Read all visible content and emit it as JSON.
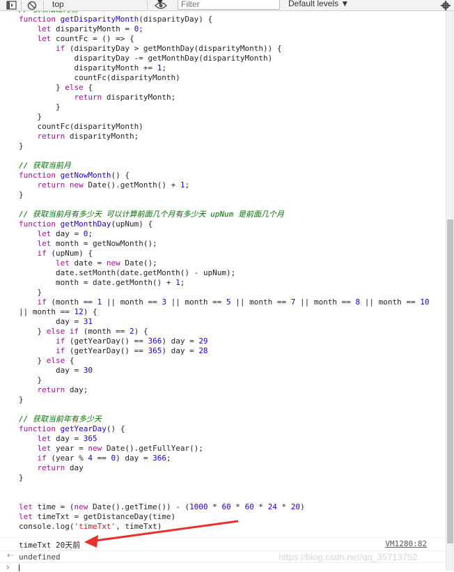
{
  "toolbar": {
    "context": "top",
    "filter_placeholder": "Filter",
    "levels": "Default levels ▼"
  },
  "code_lines": [
    "// 获取相差月份",
    "function getDisparityMonth(disparityDay) {",
    "    let disparityMonth = 0;",
    "    let countFc = () => {",
    "        if (disparityDay > getMonthDay(disparityMonth)) {",
    "            disparityDay -= getMonthDay(disparityMonth)",
    "            disparityMonth += 1;",
    "            countFc(disparityMonth)",
    "        } else {",
    "            return disparityMonth;",
    "        }",
    "    }",
    "    countFc(disparityMonth)",
    "    return disparityMonth;",
    "}",
    "",
    "// 获取当前月",
    "function getNowMonth() {",
    "    return new Date().getMonth() + 1;",
    "}",
    "",
    "// 获取当前月有多少天 可以计算前面几个月有多少天 upNum 是前面几个月",
    "function getMonthDay(upNum) {",
    "    let day = 0;",
    "    let month = getNowMonth();",
    "    if (upNum) {",
    "        let date = new Date();",
    "        date.setMonth(date.getMonth() - upNum);",
    "        month = date.getMonth() + 1;",
    "    }",
    "    if (month == 1 || month == 3 || month == 5 || month == 7 || month == 8 || month == 10",
    "|| month == 12) {",
    "        day = 31",
    "    } else if (month == 2) {",
    "        if (getYearDay() == 366) day = 29",
    "        if (getYearDay() == 365) day = 28",
    "    } else {",
    "        day = 30",
    "    }",
    "    return day;",
    "}",
    "",
    "// 获取当前年有多少天",
    "function getYearDay() {",
    "    let day = 365",
    "    let year = new Date().getFullYear();",
    "    if (year % 4 == 0) day = 366;",
    "    return day",
    "}",
    "",
    "",
    "let time = (new Date().getTime()) - (1000 * 60 * 60 * 24 * 20)",
    "let timeTxt = getDistanceDay(time)",
    "console.log('timeTxt', timeTxt)"
  ],
  "log": {
    "text": "timeTxt 20天前",
    "source": "VM1280:82"
  },
  "result": {
    "text": "undefined"
  },
  "watermark": "https://blog.csdn.net/qq_35713752",
  "colors": {
    "keyword": "#aa0d91",
    "function_name": "#1c00cf",
    "comment": "#007400",
    "string": "#c41a16",
    "arrow": "#e8312c"
  }
}
